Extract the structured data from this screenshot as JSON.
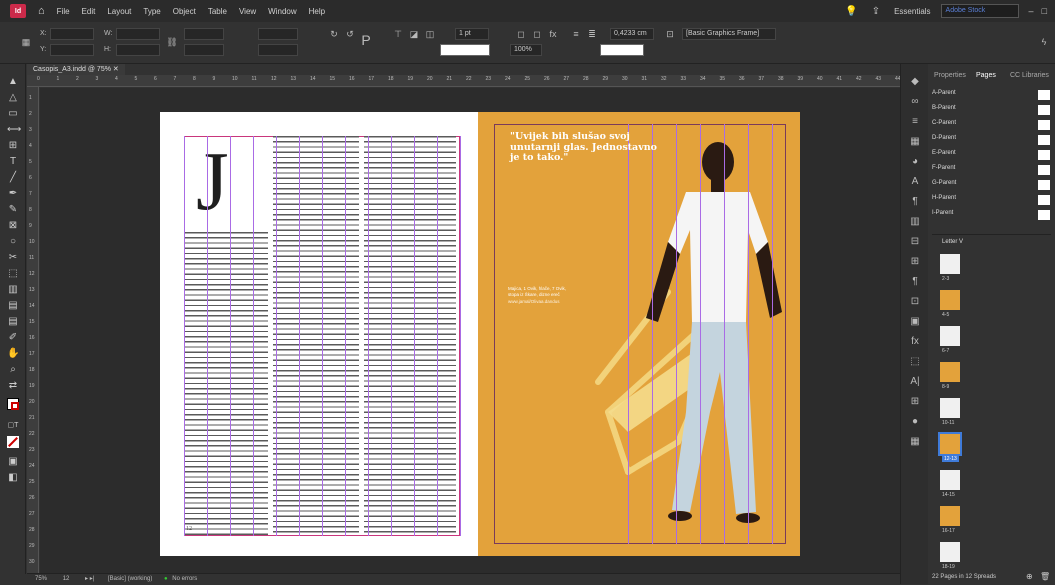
{
  "app": {
    "logo": "Id",
    "menus": [
      "File",
      "Edit",
      "Layout",
      "Type",
      "Object",
      "Table",
      "View",
      "Window",
      "Help"
    ],
    "workspace": "Essentials",
    "search_placeholder": "Adobe Stock"
  },
  "control": {
    "ref_x": "X:",
    "ref_y": "Y:",
    "w": "W:",
    "h": "H:",
    "stroke_weight": "1 pt",
    "opacity": "100%",
    "size_value": "0,4233 cm",
    "frame_style": "[Basic Graphics Frame]"
  },
  "document": {
    "tab": "Casopis_A3.indd @ 75%"
  },
  "ruler_h": [
    "0",
    "1",
    "2",
    "3",
    "4",
    "5",
    "6",
    "7",
    "8",
    "9",
    "10",
    "11",
    "12",
    "13",
    "14",
    "15",
    "16",
    "17",
    "18",
    "19",
    "20",
    "21",
    "22",
    "23",
    "24",
    "25",
    "26",
    "27",
    "28",
    "29",
    "30",
    "31",
    "32",
    "33",
    "34",
    "35",
    "36",
    "37",
    "38",
    "39",
    "40",
    "41",
    "42",
    "43",
    "44"
  ],
  "ruler_v": [
    "1",
    "2",
    "3",
    "4",
    "5",
    "6",
    "7",
    "8",
    "9",
    "10",
    "11",
    "12",
    "13",
    "14",
    "15",
    "16",
    "17",
    "18",
    "19",
    "20",
    "21",
    "22",
    "23",
    "24",
    "25",
    "26",
    "27",
    "28",
    "29",
    "30"
  ],
  "page_left": {
    "drop_cap": "J",
    "page_number": "12"
  },
  "page_right": {
    "quote": "\"Uvijek bih slušao svoj unutarnji glas. Jednostavno je to tako.\"",
    "caption": "Majica, 1 Ovik, hlače, 7 Ovik, stopa iz Škare, dizne ereč",
    "caption_credit": "www.jamal/Olivaa.dandus"
  },
  "status": {
    "zoom": "75%",
    "page": "12",
    "page_label": "[Basic] (working)",
    "errors": "No errors"
  },
  "panel": {
    "tabs": [
      "Properties",
      "Pages",
      "CC Libraries"
    ],
    "parents": [
      "A-Parent",
      "B-Parent",
      "C-Parent",
      "D-Parent",
      "E-Parent",
      "F-Parent",
      "G-Parent",
      "H-Parent",
      "I-Parent"
    ],
    "section": "Letter V",
    "spreads": [
      "2-3",
      "4-5",
      "6-7",
      "8-9",
      "10-11",
      "12-13",
      "14-15",
      "16-17",
      "18-19"
    ],
    "footer": "22 Pages in 12 Spreads"
  },
  "colors": {
    "accent_right_page": "#e3a23b",
    "margin_guide": "#c9367c",
    "column_guide": "#a96be5"
  }
}
